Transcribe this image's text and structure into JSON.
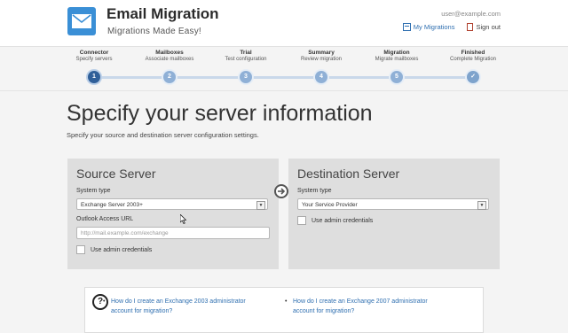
{
  "header": {
    "title": "Email Migration",
    "subtitle": "Migrations Made Easy!",
    "user_email": "user@example.com",
    "my_migrations": "My Migrations",
    "sign_out": "Sign out",
    "logo_icon": "envelope-icon",
    "accent_color": "#3a8fd6"
  },
  "steps": [
    {
      "title": "Connector",
      "subtitle": "Specify servers",
      "marker": "1",
      "state": "active"
    },
    {
      "title": "Mailboxes",
      "subtitle": "Associate mailboxes",
      "marker": "2",
      "state": "pending"
    },
    {
      "title": "Trial",
      "subtitle": "Test configuration",
      "marker": "3",
      "state": "pending"
    },
    {
      "title": "Summary",
      "subtitle": "Review migration",
      "marker": "4",
      "state": "pending"
    },
    {
      "title": "Migration",
      "subtitle": "Migrate mailboxes",
      "marker": "5",
      "state": "pending"
    },
    {
      "title": "Finished",
      "subtitle": "Complete Migration",
      "marker": "✓",
      "state": "done"
    }
  ],
  "page": {
    "title": "Specify your server information",
    "description": "Specify your source and destination server configuration settings."
  },
  "source": {
    "title": "Source Server",
    "system_type_label": "System type",
    "system_type_value": "Exchange Server 2003+",
    "outlook_label": "Outlook Access URL",
    "outlook_placeholder": "http://mail.example.com/exchange",
    "admin_label": "Use admin credentials"
  },
  "destination": {
    "title": "Destination Server",
    "system_type_label": "System type",
    "system_type_value": "Your Service Provider",
    "admin_label": "Use admin credentials"
  },
  "help": {
    "links": [
      {
        "line1": "How do I create an Exchange 2003 administrator",
        "line2": "account for migration?"
      },
      {
        "line1": "How do I create an Exchange 2007 administrator",
        "line2": "account for migration?"
      }
    ]
  }
}
